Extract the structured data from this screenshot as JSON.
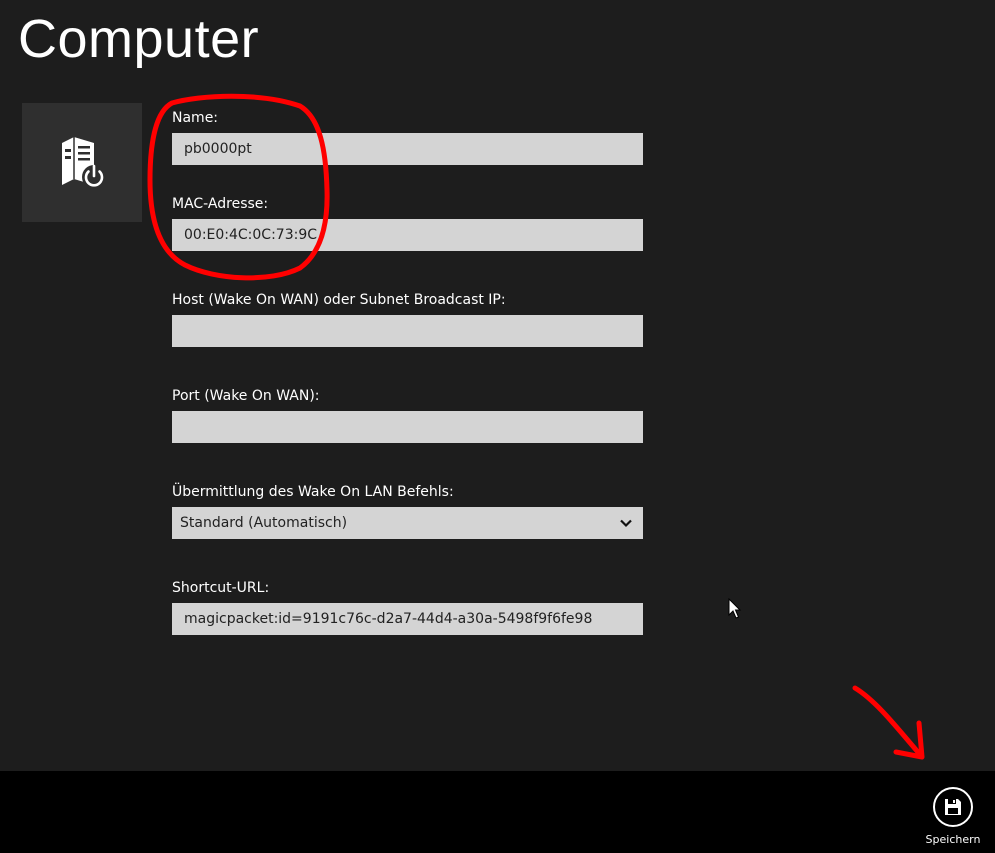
{
  "page": {
    "title": "Computer"
  },
  "tile": {
    "icon": "computer-power-icon"
  },
  "form": {
    "name_label": "Name:",
    "name_value": "pb0000pt",
    "mac_label": "MAC-Adresse:",
    "mac_value": "00:E0:4C:0C:73:9C",
    "host_label": "Host (Wake On WAN) oder Subnet Broadcast IP:",
    "host_value": "",
    "port_label": "Port (Wake On WAN):",
    "port_value": "",
    "transmission_label": "Übermittlung des Wake On LAN Befehls:",
    "transmission_value": "Standard (Automatisch)",
    "shortcut_label": "Shortcut-URL:",
    "shortcut_value": "magicpacket:id=9191c76c-d2a7-44d4-a30a-5498f9f6fe98"
  },
  "app_bar": {
    "save_label": "Speichern",
    "save_icon": "floppy-disk-icon"
  },
  "colors": {
    "background": "#1d1d1d",
    "tile": "#2f2f2f",
    "input": "#d4d4d4",
    "app_bar": "#000000",
    "annotation": "#ff0000"
  }
}
